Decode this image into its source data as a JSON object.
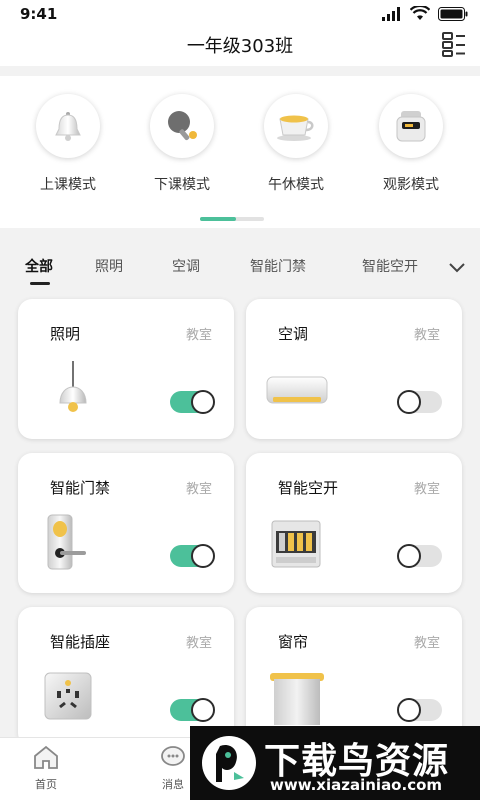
{
  "status_bar": {
    "time": "9:41"
  },
  "header": {
    "title": "一年级303班"
  },
  "modes": [
    {
      "label": "上课模式",
      "icon": "bell-icon"
    },
    {
      "label": "下课模式",
      "icon": "ping-pong-icon"
    },
    {
      "label": "午休模式",
      "icon": "coffee-cup-icon"
    },
    {
      "label": "观影模式",
      "icon": "projector-icon"
    }
  ],
  "tabs": [
    "全部",
    "照明",
    "空调",
    "智能门禁",
    "智能空开"
  ],
  "devices": [
    {
      "name": "照明",
      "room": "教室",
      "on": true,
      "icon": "pendant-lamp-icon"
    },
    {
      "name": "空调",
      "room": "教室",
      "on": false,
      "icon": "air-conditioner-icon"
    },
    {
      "name": "智能门禁",
      "room": "教室",
      "on": true,
      "icon": "door-lock-icon"
    },
    {
      "name": "智能空开",
      "room": "教室",
      "on": false,
      "icon": "circuit-breaker-icon"
    },
    {
      "name": "智能插座",
      "room": "教室",
      "on": true,
      "icon": "power-socket-icon"
    },
    {
      "name": "窗帘",
      "room": "教室",
      "on": false,
      "icon": "curtain-icon"
    }
  ],
  "bottom_nav": [
    {
      "label": "首页",
      "icon": "home-icon"
    },
    {
      "label": "消息",
      "icon": "message-icon"
    }
  ],
  "watermark": {
    "title": "下载鸟资源",
    "url": "www.xiazainiao.com"
  },
  "colors": {
    "accent": "#4cc09a",
    "toggle_off": "#e2e2e2",
    "background": "#f2f2f2"
  }
}
